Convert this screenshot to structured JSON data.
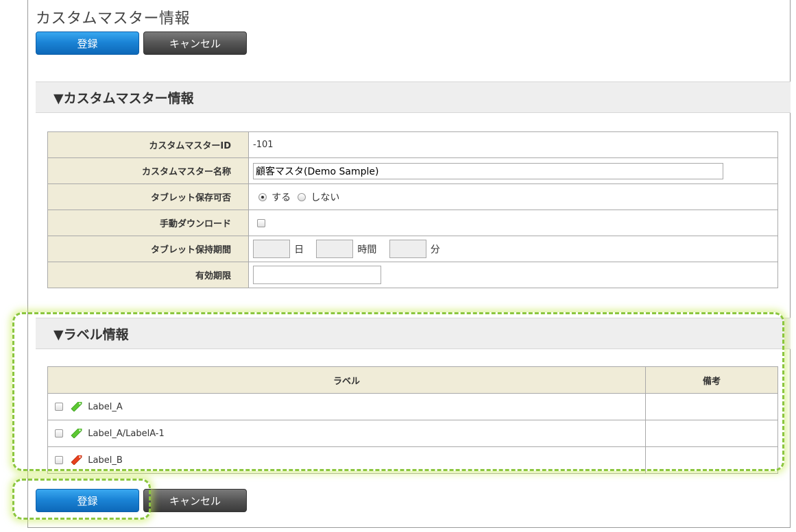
{
  "page": {
    "title": "カスタムマスター情報"
  },
  "toolbar": {
    "register_label": "登録",
    "cancel_label": "キャンセル"
  },
  "master_section": {
    "heading": "▼カスタムマスター情報",
    "fields": {
      "id_label": "カスタムマスターID",
      "id_value": "-101",
      "name_label": "カスタムマスター名称",
      "name_value": "顧客マスタ(Demo Sample)",
      "tablet_save_label": "タブレット保存可否",
      "tablet_save_yes": "する",
      "tablet_save_no": "しない",
      "manual_download_label": "手動ダウンロード",
      "retention_label": "タブレット保持期間",
      "retention_day_unit": "日",
      "retention_hour_unit": "時間",
      "retention_minute_unit": "分",
      "expiry_label": "有効期限"
    }
  },
  "label_section": {
    "heading": "▼ラベル情報",
    "columns": [
      "ラベル",
      "備考"
    ],
    "rows": [
      {
        "label": "Label_A",
        "note": "",
        "tag_color": "#5cc832"
      },
      {
        "label": "Label_A/LabelA-1",
        "note": "",
        "tag_color": "#5cc832"
      },
      {
        "label": "Label_B",
        "note": "",
        "tag_color": "#e8401e"
      }
    ]
  },
  "colors": {
    "accent_blue": "#1b84d6",
    "header_cell": "#f0ecd8",
    "highlight": "#8cc63f"
  }
}
